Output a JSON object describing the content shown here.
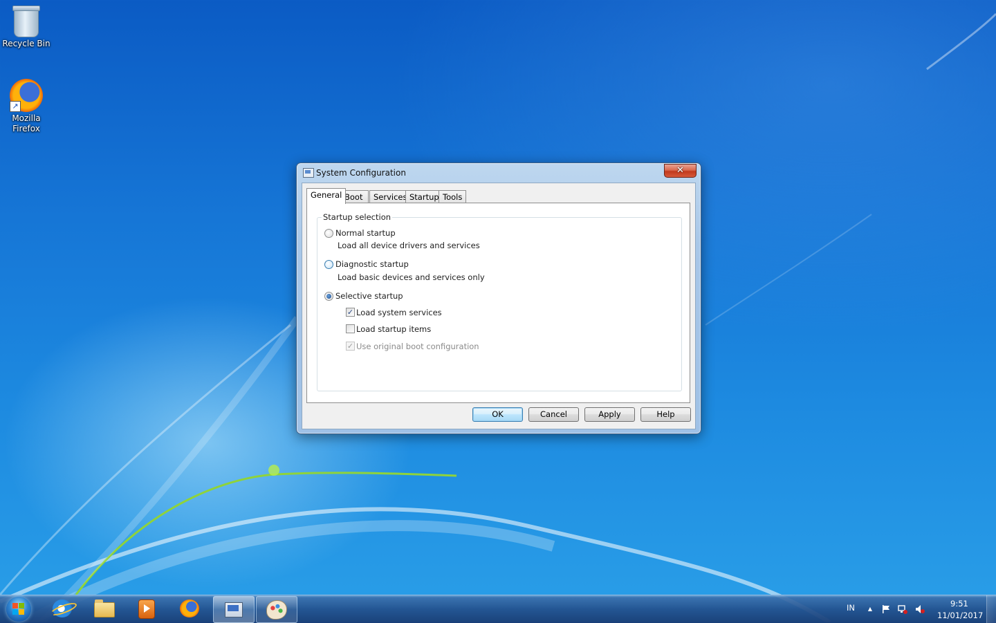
{
  "desktop": {
    "icons": [
      {
        "label": "Recycle Bin",
        "icon": "recycle-bin-icon"
      },
      {
        "label_line1": "Mozilla",
        "label_line2": "Firefox",
        "icon": "firefox-icon"
      }
    ]
  },
  "dialog": {
    "title": "System Configuration",
    "close_symbol": "✕",
    "tabs": [
      "General",
      "Boot",
      "Services",
      "Startup",
      "Tools"
    ],
    "active_tab": "General",
    "group_title": "Startup selection",
    "options": {
      "normal": {
        "label": "Normal startup",
        "desc": "Load all device drivers and services",
        "checked": false
      },
      "diagnostic": {
        "label": "Diagnostic startup",
        "desc": "Load basic devices and services only",
        "checked": false
      },
      "selective": {
        "label": "Selective startup",
        "checked": true
      }
    },
    "checkboxes": {
      "load_system_services": {
        "label": "Load system services",
        "checked": true,
        "enabled": true
      },
      "load_startup_items": {
        "label": "Load startup items",
        "checked": false,
        "enabled": true
      },
      "use_original_boot": {
        "label": "Use original boot configuration",
        "checked": true,
        "enabled": false
      }
    },
    "buttons": {
      "ok": "OK",
      "cancel": "Cancel",
      "apply": "Apply",
      "help": "Help"
    },
    "check_mark": "✓"
  },
  "taskbar": {
    "pinned": [
      "start-button",
      "internet-explorer-icon",
      "windows-explorer-icon",
      "media-player-icon",
      "firefox-icon",
      "system-configuration-icon",
      "paint-icon"
    ],
    "tray": {
      "language": "IN",
      "up_arrow": "▲",
      "time": "9:51",
      "date": "11/01/2017"
    }
  },
  "colors": {
    "accent": "#3c7fb1",
    "close_red": "#c2391d",
    "desktop_blue": "#1676d6"
  }
}
